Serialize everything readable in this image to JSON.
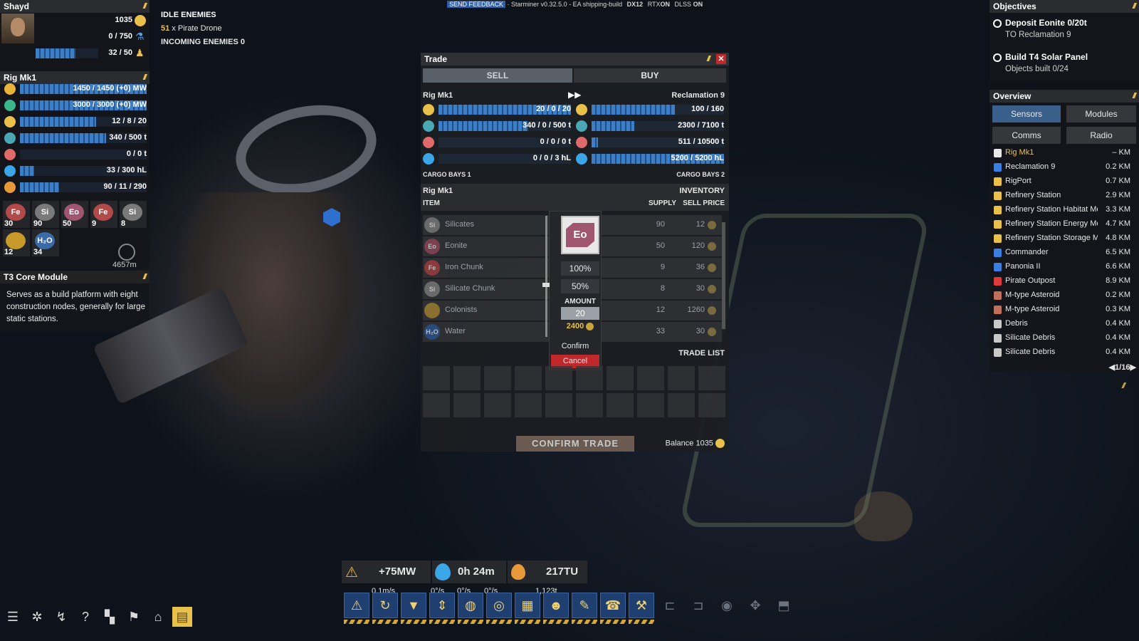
{
  "top_bar": {
    "feedback": "SEND FEEDBACK",
    "version": "· Starminer v0.32.5.0 - EA shipping-build",
    "dx": "DX12",
    "rtx": "RTX",
    "rtx_state": "ON",
    "dlss": "DLSS",
    "dlss_state": "ON"
  },
  "player": {
    "name": "Shayd",
    "credits": "1035",
    "science": "0 / 750",
    "colonists": "32 / 50",
    "colonists_fill": 0.64
  },
  "ship": {
    "name": "Rig Mk1",
    "stats": [
      {
        "icon": "power-icon",
        "color": "#e8b53a",
        "value": "1450 / 1450  (+0) MW",
        "fill": 1.0
      },
      {
        "icon": "battery-icon",
        "color": "#3bb58a",
        "value": "3000 / 3000  (+0) MW",
        "fill": 1.0
      },
      {
        "icon": "crew-icon",
        "color": "#e8c04a",
        "value": "12 / 8 / 20",
        "fill": 0.6
      },
      {
        "icon": "ore-icon",
        "color": "#4aa8b5",
        "value": "340 / 500 t",
        "fill": 0.68
      },
      {
        "icon": "gas-icon",
        "color": "#e06a6a",
        "value": "0 / 0 t",
        "fill": 0.0
      },
      {
        "icon": "water-icon",
        "color": "#3aa6e8",
        "value": "33 / 300 hL",
        "fill": 0.11
      },
      {
        "icon": "fuel-icon",
        "color": "#e89a3a",
        "value": "90 / 11 / 290",
        "fill": 0.31
      }
    ],
    "resources": [
      {
        "symbol": "Fe",
        "count": "30",
        "color": "#b24a4a"
      },
      {
        "symbol": "Si",
        "count": "90",
        "color": "#7a7a7a"
      },
      {
        "symbol": "Eo",
        "count": "50",
        "color": "#a0566f"
      },
      {
        "symbol": "Fe",
        "count": "9",
        "color": "#b24a4a"
      },
      {
        "symbol": "Si",
        "count": "8",
        "color": "#7a7a7a"
      },
      {
        "symbol": "",
        "count": "12",
        "color": "#c79a2a"
      },
      {
        "symbol": "H₂O",
        "count": "34",
        "color": "#3a6aa8"
      }
    ],
    "distance": "4657m"
  },
  "module": {
    "title": "T3 Core Module",
    "desc": "Serves as a build platform with eight construction nodes, generally for large static stations."
  },
  "enemies": {
    "idle_label": "IDLE ENEMIES",
    "idle_count": "51",
    "idle_type": "x Pirate Drone",
    "incoming_label": "INCOMING ENEMIES",
    "incoming_count": "0"
  },
  "trade": {
    "title": "Trade",
    "tab_sell": "SELL",
    "tab_buy": "BUY",
    "left_name": "Rig Mk1",
    "right_name": "Reclamation 9",
    "left_rows": [
      {
        "icon": "crew-icon",
        "color": "#e8c04a",
        "value": "20 / 0 / 20",
        "fill": 1.0
      },
      {
        "icon": "ore-icon",
        "color": "#4aa8b5",
        "value": "340 / 0 / 500 t",
        "fill": 0.68
      },
      {
        "icon": "gas-icon",
        "color": "#e06a6a",
        "value": "0 / 0 / 0 t",
        "fill": 0.0
      },
      {
        "icon": "water-icon",
        "color": "#3aa6e8",
        "value": "0 / 0 / 3 hL",
        "fill": 0.0
      }
    ],
    "right_rows": [
      {
        "icon": "crew-icon",
        "color": "#e8c04a",
        "value": "100 / 160",
        "fill": 0.63
      },
      {
        "icon": "ore-icon",
        "color": "#4aa8b5",
        "value": "2300 / 7100 t",
        "fill": 0.32
      },
      {
        "icon": "gas-icon",
        "color": "#e06a6a",
        "value": "511 / 10500 t",
        "fill": 0.05
      },
      {
        "icon": "water-icon",
        "color": "#3aa6e8",
        "value": "5200 / 5200 hL",
        "fill": 1.0
      }
    ],
    "cargo_left": "CARGO BAYS 1",
    "cargo_right": "CARGO BAYS 2",
    "inv_ship": "Rig Mk1",
    "inv_label": "INVENTORY",
    "col_item": "ITEM",
    "col_supply": "SUPPLY",
    "col_price": "SELL PRICE",
    "items": [
      {
        "symbol": "Si",
        "name": "Silicates",
        "supply": "90",
        "price": "12"
      },
      {
        "symbol": "Eo",
        "name": "Eonite",
        "supply": "50",
        "price": "120"
      },
      {
        "symbol": "Fe",
        "name": "Iron Chunk",
        "supply": "9",
        "price": "36"
      },
      {
        "symbol": "Si",
        "name": "Silicate Chunk",
        "supply": "8",
        "price": "30"
      },
      {
        "symbol": "",
        "name": "Colonists",
        "supply": "12",
        "price": "1260"
      },
      {
        "symbol": "H₂O",
        "name": "Water",
        "supply": "33",
        "price": "30"
      }
    ],
    "popup": {
      "symbol": "Eo",
      "pct_100": "100%",
      "pct_50": "50%",
      "amount_label": "AMOUNT",
      "amount_value": "20",
      "total": "2400",
      "confirm": "Confirm",
      "cancel": "Cancel"
    },
    "trade_list": "TRADE LIST",
    "confirm_trade": "CONFIRM TRADE",
    "balance_label": "Balance",
    "balance_value": "1035"
  },
  "objectives": {
    "title": "Objectives",
    "items": [
      {
        "title": "Deposit Eonite 0/20t",
        "sub": "TO Reclamation 9"
      },
      {
        "title": "Build T4 Solar Panel",
        "sub": "Objects built 0/24"
      }
    ]
  },
  "overview": {
    "title": "Overview",
    "tabs": [
      "Sensors",
      "Modules",
      "Comms",
      "Radio"
    ],
    "items": [
      {
        "name": "Rig Mk1",
        "dist": "– KM",
        "color": "#e8e8e8",
        "highlight": true
      },
      {
        "name": "Reclamation 9",
        "dist": "0.2 KM",
        "color": "#3a7ee0"
      },
      {
        "name": "RigPort",
        "dist": "0.7 KM",
        "color": "#e8c04a"
      },
      {
        "name": "Refinery Station",
        "dist": "2.9 KM",
        "color": "#e8c04a"
      },
      {
        "name": "Refinery Station Habitat Mo",
        "dist": "3.3 KM",
        "color": "#e8c04a"
      },
      {
        "name": "Refinery Station Energy Mo",
        "dist": "4.7 KM",
        "color": "#e8c04a"
      },
      {
        "name": "Refinery Station Storage Mo",
        "dist": "4.8 KM",
        "color": "#e8c04a"
      },
      {
        "name": "Commander",
        "dist": "6.5 KM",
        "color": "#3a7ee0"
      },
      {
        "name": "Panonia II",
        "dist": "6.6 KM",
        "color": "#3a7ee0"
      },
      {
        "name": "Pirate Outpost",
        "dist": "8.9 KM",
        "color": "#e03a3a"
      },
      {
        "name": "M-type Asteroid",
        "dist": "0.2 KM",
        "color": "#c0705a"
      },
      {
        "name": "M-type Asteroid",
        "dist": "0.3 KM",
        "color": "#c0705a"
      },
      {
        "name": "Debris",
        "dist": "0.4 KM",
        "color": "#c8c8c8"
      },
      {
        "name": "Silicate Debris",
        "dist": "0.4 KM",
        "color": "#c8c8c8"
      },
      {
        "name": "Silicate Debris",
        "dist": "0.4 KM",
        "color": "#c8c8c8"
      }
    ],
    "page": "1/16"
  },
  "bottom_stats": {
    "power": "+75MW",
    "time": "0h 24m",
    "fuel": "217TU",
    "speed": "0.1m/s",
    "rot1": "0°/s",
    "rot2": "0°/s",
    "rot3": "0°/s",
    "mass": "1,123t"
  },
  "toolbar": {
    "active": [
      "power-icon",
      "grapple-icon",
      "scanner-icon",
      "drill-icon",
      "globe-icon",
      "target-icon",
      "cargo-icon",
      "crew-icon",
      "build-icon",
      "comms-icon",
      "repair-icon"
    ],
    "inactive": [
      "dock-icon",
      "undock-icon",
      "center-icon",
      "move-icon",
      "tractor-icon"
    ]
  },
  "bottom_left": [
    "menu-icon",
    "map-icon",
    "fleet-icon",
    "help-icon",
    "layout-icon",
    "flag-icon",
    "home-icon",
    "notes-icon"
  ]
}
